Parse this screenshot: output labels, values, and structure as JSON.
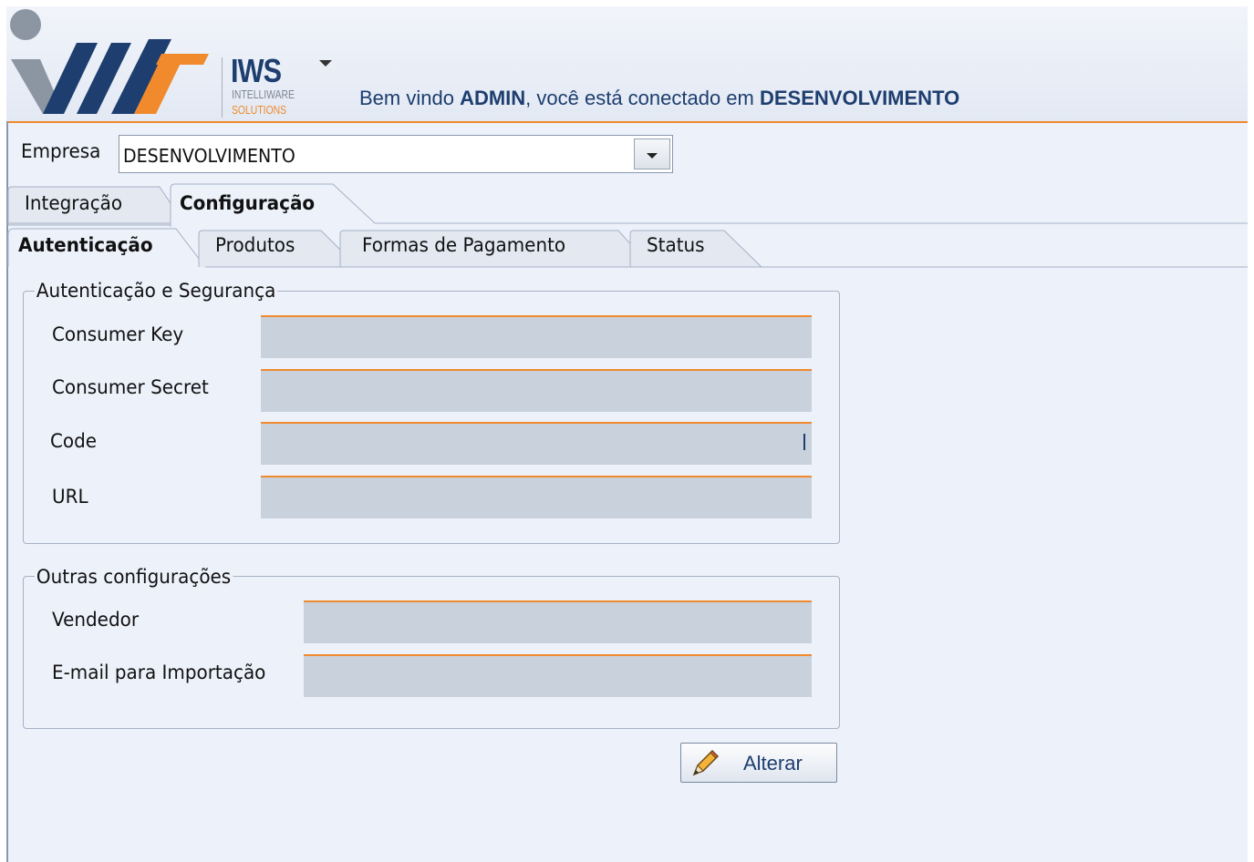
{
  "header": {
    "brand": {
      "name": "IWS",
      "line1": "INTELLIWARE",
      "line2": "SOLUTIONS"
    },
    "welcome": {
      "prefix": "Bem vindo ",
      "user": "ADMIN",
      "middle": ", você está conectado em ",
      "company": "DESENVOLVIMENTO"
    },
    "menu_icon": "caret-down-icon"
  },
  "empresa": {
    "label": "Empresa",
    "value": "DESENVOLVIMENTO"
  },
  "main_tabs": [
    {
      "label": "Integração",
      "active": false
    },
    {
      "label": "Configuração",
      "active": true
    }
  ],
  "sub_tabs": [
    {
      "label": "Autenticação",
      "active": true
    },
    {
      "label": "Produtos",
      "active": false
    },
    {
      "label": "Formas de Pagamento",
      "active": false
    },
    {
      "label": "Status",
      "active": false
    }
  ],
  "auth_group": {
    "title": "Autenticação e Segurança",
    "fields": [
      {
        "label": "Consumer Key",
        "value": ""
      },
      {
        "label": "Consumer Secret",
        "value": ""
      },
      {
        "label": "Code",
        "value": ""
      },
      {
        "label": "URL",
        "value": ""
      }
    ]
  },
  "other_group": {
    "title": "Outras configurações",
    "fields": [
      {
        "label": "Vendedor",
        "value": ""
      },
      {
        "label": "E-mail para Importação",
        "value": ""
      }
    ]
  },
  "actions": {
    "alterar_label": "Alterar",
    "alterar_icon": "pencil-icon"
  },
  "colors": {
    "accent_orange": "#f08a2c",
    "brand_navy": "#1d3e6e",
    "input_bg": "#c8d1dc",
    "panel_bg": "#edf1fa"
  }
}
